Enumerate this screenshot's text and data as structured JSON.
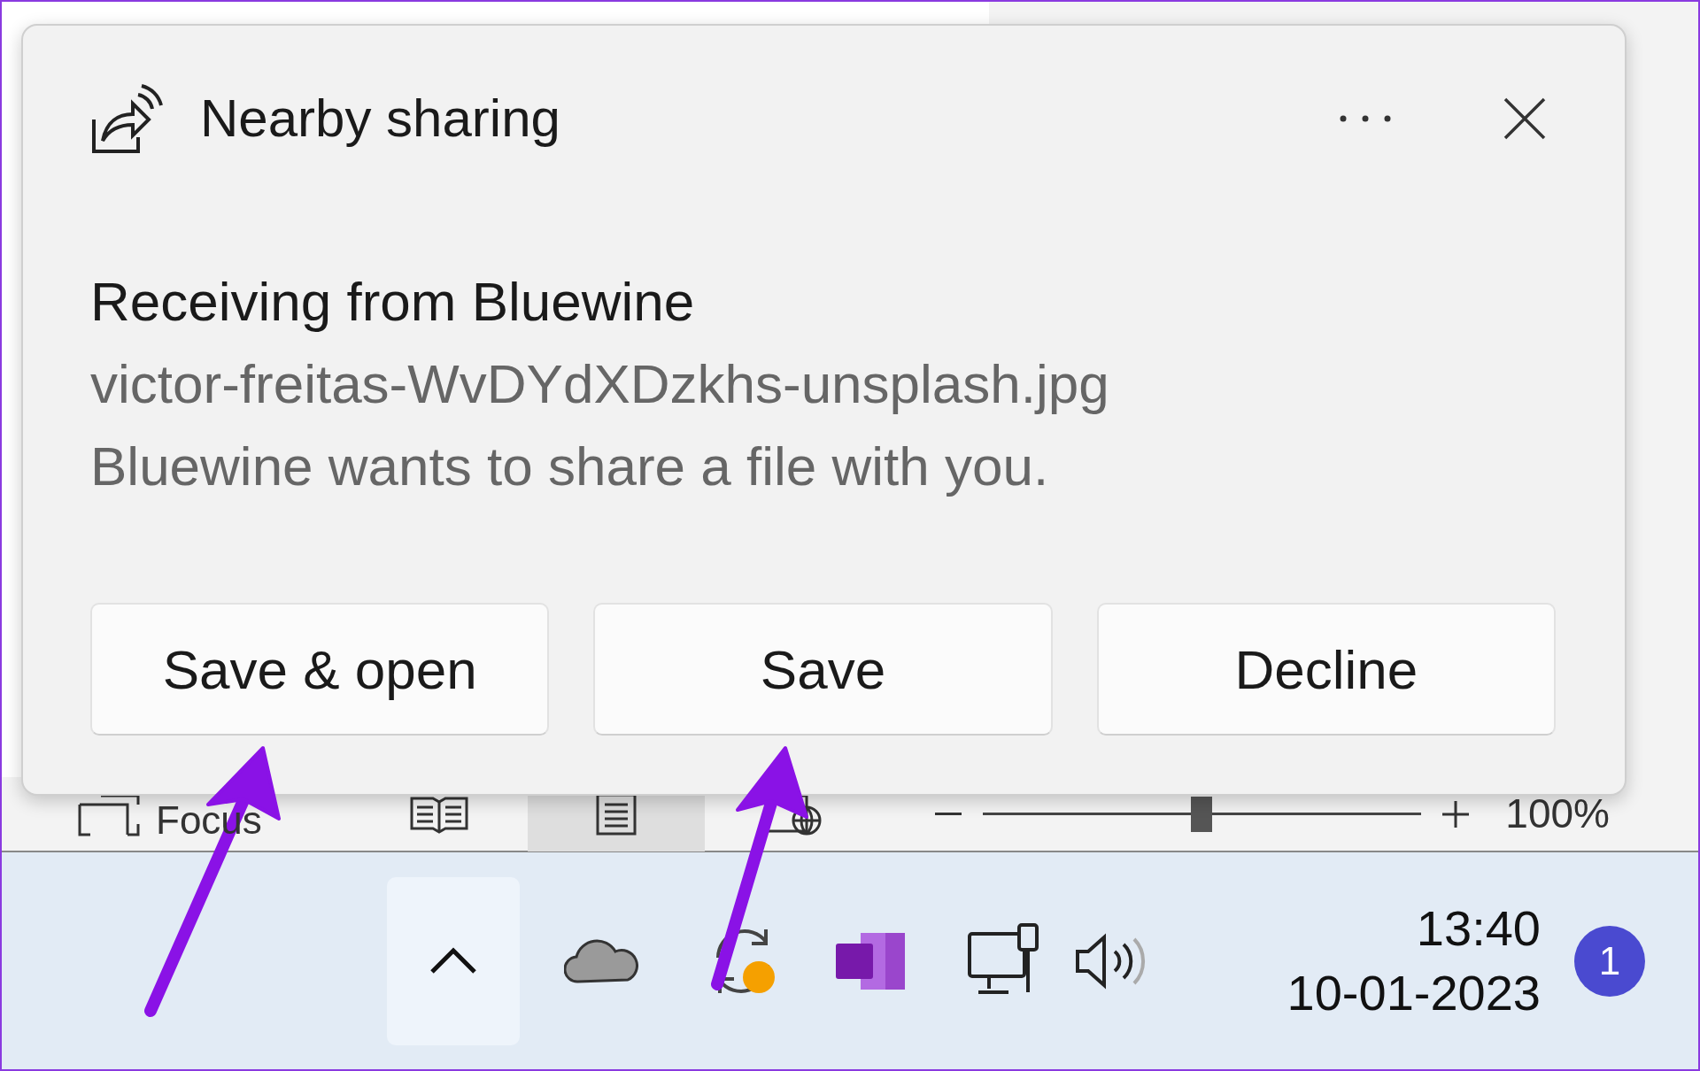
{
  "notification": {
    "app_title": "Nearby sharing",
    "heading": "Receiving from Bluewine",
    "filename": "victor-freitas-WvDYdXDzkhs-unsplash.jpg",
    "message": "Bluewine wants to share a file with you.",
    "buttons": [
      "Save & open",
      "Save",
      "Decline"
    ]
  },
  "status_bar": {
    "focus_label": "Focus",
    "views": [
      {
        "kind": "read",
        "selected": false
      },
      {
        "kind": "print",
        "selected": true
      },
      {
        "kind": "web",
        "selected": false
      }
    ],
    "zoom": {
      "level": 0.5,
      "reading": "100%"
    }
  },
  "taskbar": {
    "time": "13:40",
    "date": "10-01-2023",
    "notification_count": "1"
  }
}
